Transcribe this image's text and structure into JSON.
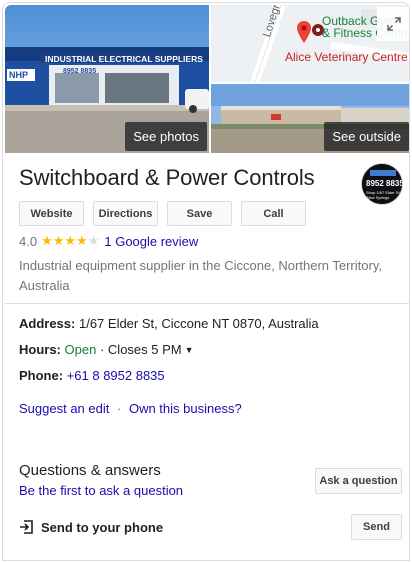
{
  "photos": {
    "see_photos_label": "See photos",
    "see_outside_label": "See outside",
    "storefront_sign_text": "INDUSTRIAL ELECTRICAL SUPPLIERS",
    "storefront_phone_text": "8952 8835",
    "storefront_brand_text": "NHP",
    "map": {
      "street_label": "Lovegrove Dr",
      "place_top_line1": "Outback Gym",
      "place_top_line2": "& Fitness Centre",
      "place_pin_label": "Alice Veterinary Centre"
    }
  },
  "business": {
    "name": "Switchboard & Power Controls",
    "logo_text_line1": "8952 8835",
    "logo_text_line2": "Shop 1/67 Elder St Alice Springs",
    "rating": "4.0",
    "stars_filled": 4,
    "stars_total": 5,
    "reviews_link": "1 Google review",
    "category": "Industrial equipment supplier in the Ciccone, Northern Territory, Australia"
  },
  "actions": {
    "website": "Website",
    "directions": "Directions",
    "save": "Save",
    "call": "Call"
  },
  "details": {
    "address_label": "Address:",
    "address_value": "1/67 Elder St, Ciccone NT 0870, Australia",
    "hours_label": "Hours:",
    "hours_open": "Open",
    "hours_sep": "·",
    "hours_close": "Closes 5 PM",
    "phone_label": "Phone:",
    "phone_value": "+61 8 8952 8835"
  },
  "links": {
    "suggest_edit": "Suggest an edit",
    "separator": "·",
    "own_business": "Own this business?"
  },
  "qa": {
    "title": "Questions & answers",
    "first_to_ask": "Be the first to ask a question",
    "ask_button": "Ask a question"
  },
  "send": {
    "label": "Send to your phone",
    "button": "Send"
  },
  "colors": {
    "link": "#1a0dab",
    "open_green": "#188038",
    "star": "#fbbc04",
    "pin_red": "#ea4335",
    "map_green_text": "#188038",
    "map_red_text": "#c5221f"
  }
}
